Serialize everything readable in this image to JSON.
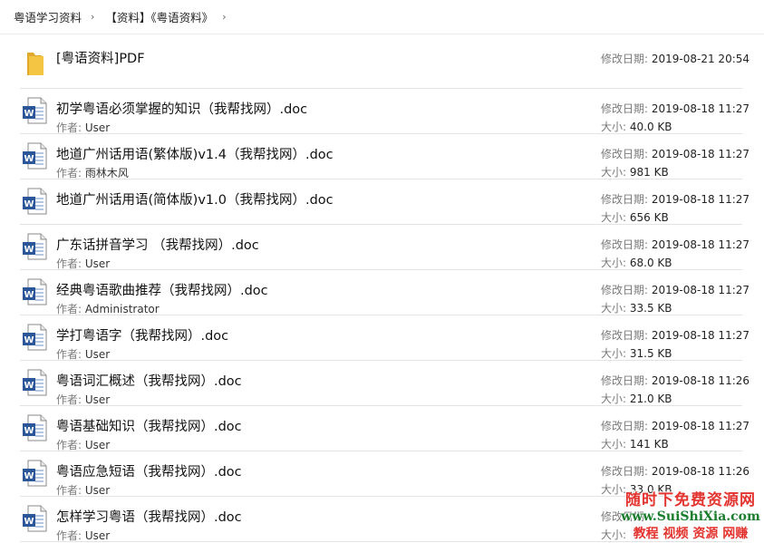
{
  "breadcrumb": {
    "items": [
      "粤语学习资料",
      "【资料】《粤语资料》"
    ]
  },
  "labels": {
    "date": "修改日期:",
    "author": "作者:",
    "size": "大小:"
  },
  "folder": {
    "name": "[粤语资料]PDF",
    "date": "2019-08-21 20:54"
  },
  "files": [
    {
      "name": "初学粤语必须掌握的知识（我帮找网）.doc",
      "author": "User",
      "date": "2019-08-18 11:27",
      "size": "40.0 KB"
    },
    {
      "name": "地道广州话用语(繁体版)v1.4（我帮找网）.doc",
      "author": "雨林木风",
      "date": "2019-08-18 11:27",
      "size": "981 KB"
    },
    {
      "name": "地道广州话用语(简体版)v1.0（我帮找网）.doc",
      "author": "",
      "date": "2019-08-18 11:27",
      "size": "656 KB"
    },
    {
      "name": "广东话拼音学习 （我帮找网）.doc",
      "author": "User",
      "date": "2019-08-18 11:27",
      "size": "68.0 KB"
    },
    {
      "name": "经典粤语歌曲推荐（我帮找网）.doc",
      "author": "Administrator",
      "date": "2019-08-18 11:27",
      "size": "33.5 KB"
    },
    {
      "name": "学打粤语字（我帮找网）.doc",
      "author": "User",
      "date": "2019-08-18 11:27",
      "size": "31.5 KB"
    },
    {
      "name": "粤语词汇概述（我帮找网）.doc",
      "author": "User",
      "date": "2019-08-18 11:26",
      "size": "21.0 KB"
    },
    {
      "name": "粤语基础知识（我帮找网）.doc",
      "author": "User",
      "date": "2019-08-18 11:27",
      "size": "141 KB"
    },
    {
      "name": "粤语应急短语（我帮找网）.doc",
      "author": "User",
      "date": "2019-08-18 11:26",
      "size": "33.0 KB"
    },
    {
      "name": "怎样学习粤语（我帮找网）.doc",
      "author": "User",
      "date": "",
      "size": ""
    }
  ],
  "watermark": {
    "line1": "随时下免费资源网",
    "line2": "www.SuiShiXia.com",
    "line3": "教程 视频 资源 网赚"
  },
  "icons": {
    "folder": "folder-icon",
    "word": "word-doc-icon",
    "separator": "chevron-right-icon"
  },
  "colors": {
    "word_blue": "#2b579a",
    "folder_yellow": "#f4c542"
  }
}
